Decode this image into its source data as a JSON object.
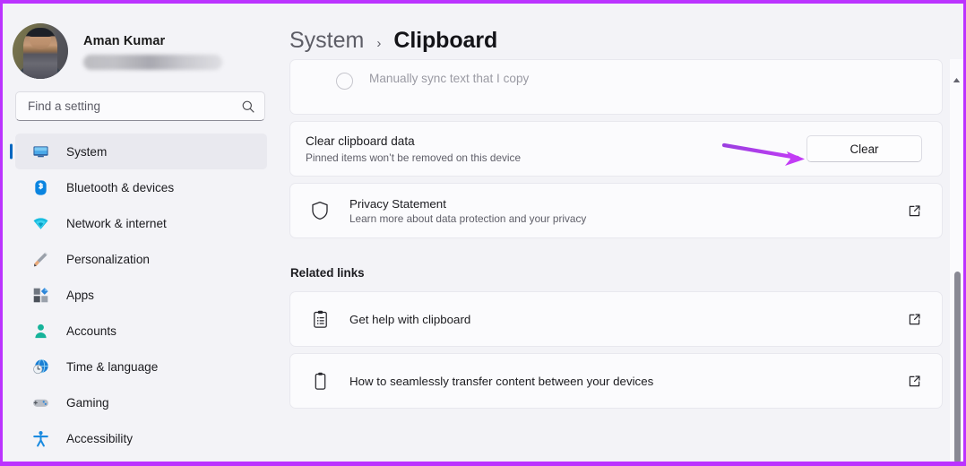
{
  "window": {
    "border_color": "#bb33ff",
    "background": "#f3f3f7"
  },
  "sidebar": {
    "profile": {
      "name": "Aman Kumar",
      "email_redacted": true,
      "avatar_icon": "user-avatar-photo"
    },
    "search": {
      "placeholder": "Find a setting",
      "value": "",
      "icon": "search-icon"
    },
    "selected_accent_color": "#0067c0",
    "items": [
      {
        "label": "System",
        "icon": "system-monitor-icon",
        "selected": true
      },
      {
        "label": "Bluetooth & devices",
        "icon": "bluetooth-icon",
        "selected": false
      },
      {
        "label": "Network & internet",
        "icon": "wifi-icon",
        "selected": false
      },
      {
        "label": "Personalization",
        "icon": "paintbrush-icon",
        "selected": false
      },
      {
        "label": "Apps",
        "icon": "apps-grid-icon",
        "selected": false
      },
      {
        "label": "Accounts",
        "icon": "person-icon",
        "selected": false
      },
      {
        "label": "Time & language",
        "icon": "clock-globe-icon",
        "selected": false
      },
      {
        "label": "Gaming",
        "icon": "gamepad-icon",
        "selected": false
      },
      {
        "label": "Accessibility",
        "icon": "accessibility-icon",
        "selected": false
      }
    ]
  },
  "header": {
    "breadcrumb_root": "System",
    "breadcrumb_separator": "›",
    "breadcrumb_current": "Clipboard"
  },
  "main": {
    "sync_card": {
      "option_label": "Manually sync text that I copy",
      "radio_state": "unselected-disabled"
    },
    "clear_card": {
      "title": "Clear clipboard data",
      "subtitle": "Pinned items won’t be removed on this device",
      "button_label": "Clear"
    },
    "privacy_card": {
      "icon": "shield-icon",
      "title": "Privacy Statement",
      "subtitle": "Learn more about data protection and your privacy",
      "external_icon": "external-link-icon"
    },
    "related_links": {
      "heading": "Related links",
      "items": [
        {
          "label": "Get help with clipboard",
          "icon": "clipboard-list-icon",
          "external_icon": "external-link-icon"
        },
        {
          "label": "How to seamlessly transfer content between your devices",
          "icon": "clipboard-icon",
          "external_icon": "external-link-icon"
        }
      ]
    }
  },
  "annotation": {
    "arrow": {
      "name": "highlight-arrow",
      "color_start": "#9b3fe0",
      "color_end": "#c23cf5",
      "points_to": "Clear"
    }
  },
  "scrollbar": {
    "up_arrow_icon": "scroll-up-arrow-icon",
    "thumb_color": "#8a8a94"
  }
}
